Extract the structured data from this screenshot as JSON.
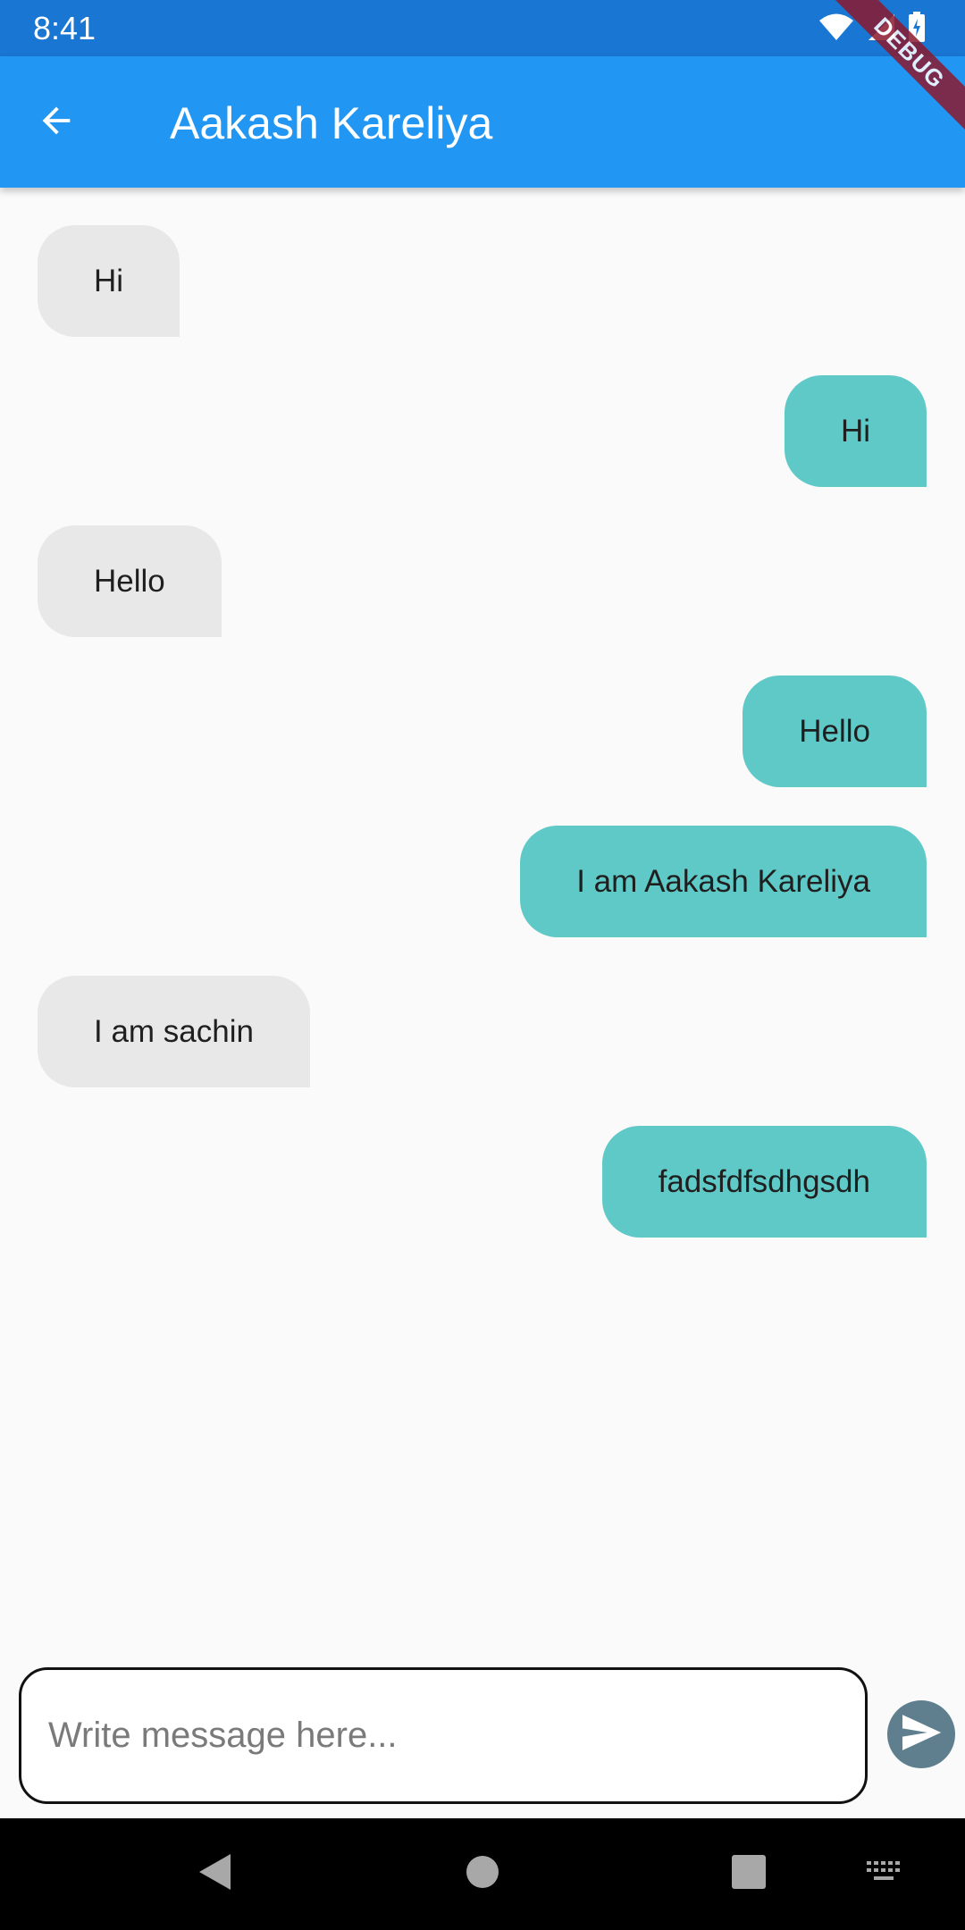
{
  "status_bar": {
    "time": "8:41",
    "icons": [
      "wifi-icon",
      "cell-signal-icon",
      "battery-charging-icon"
    ]
  },
  "debug_banner": "DEBUG",
  "app_bar": {
    "back_icon": "arrow-back-icon",
    "title": "Aakash Kareliya",
    "color": "#2196f3"
  },
  "messages": [
    {
      "text": "Hi",
      "direction": "received"
    },
    {
      "text": "Hi",
      "direction": "sent"
    },
    {
      "text": "Hello",
      "direction": "received"
    },
    {
      "text": "Hello",
      "direction": "sent"
    },
    {
      "text": "I am Aakash Kareliya",
      "direction": "sent"
    },
    {
      "text": "I am sachin",
      "direction": "received"
    },
    {
      "text": "fadsfdfsdhgsdh",
      "direction": "sent"
    }
  ],
  "colors": {
    "received_bubble": "#e8e8e8",
    "sent_bubble": "#5fc9c7",
    "send_button": "#5f7f8f"
  },
  "composer": {
    "placeholder": "Write message here...",
    "value": "",
    "send_icon": "send-icon"
  },
  "nav_bar": {
    "icons": [
      "back-triangle-icon",
      "home-circle-icon",
      "recents-square-icon",
      "keyboard-icon"
    ]
  }
}
